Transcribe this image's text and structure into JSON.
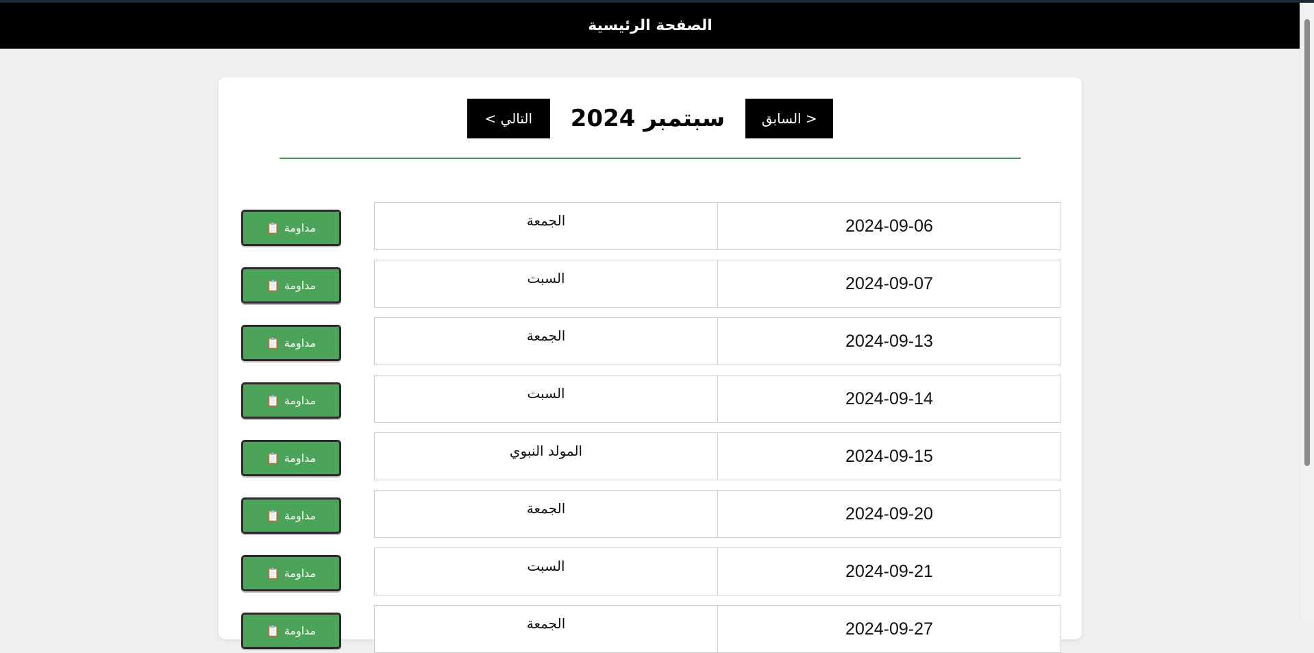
{
  "header": {
    "title": "الصفحة الرئيسية"
  },
  "calendar": {
    "month_title": "سبتمبر 2024",
    "prev_label": "< السابق",
    "next_label": "التالي >"
  },
  "attendance_button": {
    "label": "مداومة",
    "icon": "clipboard-icon"
  },
  "colors": {
    "accent": "#4ca35a",
    "topbar": "#000000"
  },
  "rows": [
    {
      "date": "2024-09-06",
      "day": "الجمعة"
    },
    {
      "date": "2024-09-07",
      "day": "السبت"
    },
    {
      "date": "2024-09-13",
      "day": "الجمعة"
    },
    {
      "date": "2024-09-14",
      "day": "السبت"
    },
    {
      "date": "2024-09-15",
      "day": "المولد النبوي"
    },
    {
      "date": "2024-09-20",
      "day": "الجمعة"
    },
    {
      "date": "2024-09-21",
      "day": "السبت"
    },
    {
      "date": "2024-09-27",
      "day": "الجمعة"
    }
  ]
}
